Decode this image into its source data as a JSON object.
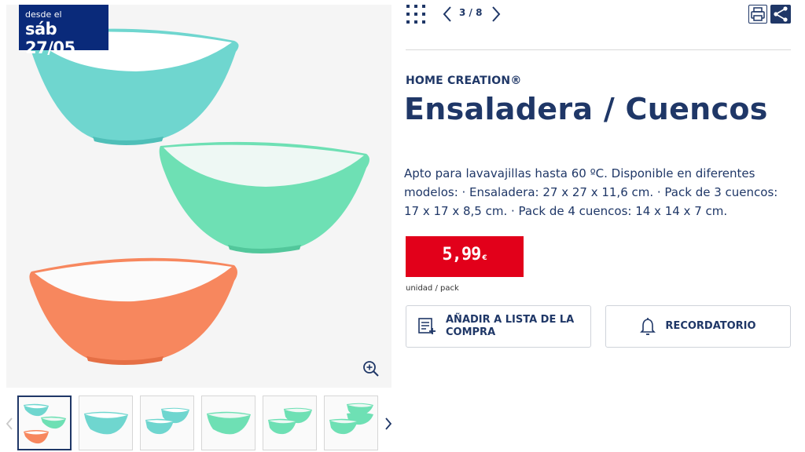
{
  "badge": {
    "line1": "desde el",
    "line2": "sáb 27/05"
  },
  "gallery": {
    "icons": {
      "zoom": "zoom-in-icon",
      "prev": "chevron-left-icon",
      "next": "chevron-right-icon"
    },
    "thumbnails": [
      {
        "name": "thumbnail-1-set",
        "active": true
      },
      {
        "name": "thumbnail-2-turquoise",
        "active": false
      },
      {
        "name": "thumbnail-3-stack",
        "active": false
      },
      {
        "name": "thumbnail-4-green",
        "active": false
      },
      {
        "name": "thumbnail-5-green-pair",
        "active": false
      },
      {
        "name": "thumbnail-6-green-stack",
        "active": false
      }
    ]
  },
  "header": {
    "counter": "3 / 8",
    "icons": {
      "grid": "grid-icon",
      "prev": "chevron-left-icon",
      "next": "chevron-right-icon",
      "print": "print-icon",
      "share": "share-icon"
    }
  },
  "product": {
    "brand": "HOME CREATION®",
    "title": "Ensaladera / Cuencos",
    "description": "Apto para lavavajillas hasta 60 ºC. Disponible en diferentes modelos: · Ensaladera: 27 x 27 x 11,6 cm. · Pack de 3 cuencos: 17 x 17 x 8,5 cm. · Pack de 4 cuencos: 14 x 14 x 7 cm.",
    "price": "5,99",
    "currency": "€",
    "unit": "unidad / pack"
  },
  "actions": {
    "add_to_list": "AÑADIR A LISTA DE LA COMPRA",
    "reminder": "RECORDATORIO"
  },
  "colors": {
    "navy": "#1f3767",
    "badge": "#0a2a7a",
    "price_red": "#e2001a",
    "bowl_turquoise": "#6fd6cf",
    "bowl_green": "#6ee0b4",
    "bowl_orange": "#f7875e"
  }
}
